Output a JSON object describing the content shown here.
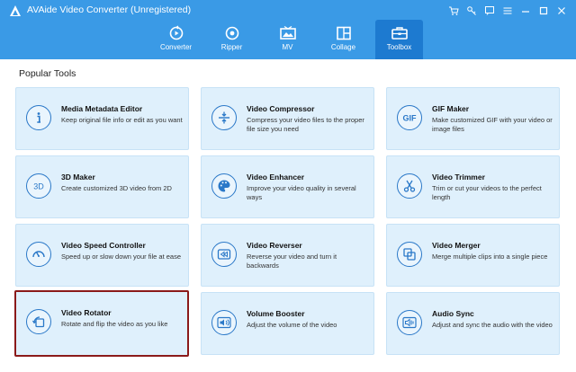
{
  "window": {
    "title": "AVAide Video Converter (Unregistered)"
  },
  "nav": {
    "tabs": [
      {
        "label": "Converter",
        "icon": "converter-icon"
      },
      {
        "label": "Ripper",
        "icon": "ripper-icon"
      },
      {
        "label": "MV",
        "icon": "mv-icon"
      },
      {
        "label": "Collage",
        "icon": "collage-icon"
      },
      {
        "label": "Toolbox",
        "icon": "toolbox-icon",
        "active": true
      }
    ]
  },
  "main": {
    "section_title": "Popular Tools",
    "tools": [
      {
        "title": "Media Metadata Editor",
        "desc": "Keep original file info or edit as you want",
        "icon": "info-icon"
      },
      {
        "title": "Video Compressor",
        "desc": "Compress your video files to the proper file size you need",
        "icon": "compress-icon"
      },
      {
        "title": "GIF Maker",
        "desc": "Make customized GIF with your video or image files",
        "icon": "gif-icon"
      },
      {
        "title": "3D Maker",
        "desc": "Create customized 3D video from 2D",
        "icon": "3d-icon"
      },
      {
        "title": "Video Enhancer",
        "desc": "Improve your video quality in several ways",
        "icon": "palette-icon"
      },
      {
        "title": "Video Trimmer",
        "desc": "Trim or cut your videos to the perfect length",
        "icon": "scissors-icon"
      },
      {
        "title": "Video Speed Controller",
        "desc": "Speed up or slow down your file at ease",
        "icon": "speedometer-icon"
      },
      {
        "title": "Video Reverser",
        "desc": "Reverse your video and turn it backwards",
        "icon": "rewind-icon"
      },
      {
        "title": "Video Merger",
        "desc": "Merge multiple clips into a single piece",
        "icon": "merge-icon"
      },
      {
        "title": "Video Rotator",
        "desc": "Rotate and flip the video as you like",
        "icon": "rotate-icon",
        "selected": true
      },
      {
        "title": "Volume Booster",
        "desc": "Adjust the volume of the video",
        "icon": "volume-icon"
      },
      {
        "title": "Audio Sync",
        "desc": "Adjust and sync the audio with the video",
        "icon": "audio-sync-icon"
      }
    ]
  },
  "colors": {
    "header": "#3a9ae6",
    "active_tab": "#1d7ad0",
    "card_bg": "#dff0fc",
    "icon_stroke": "#2a78c8",
    "selected_border": "#8b1a1a"
  }
}
